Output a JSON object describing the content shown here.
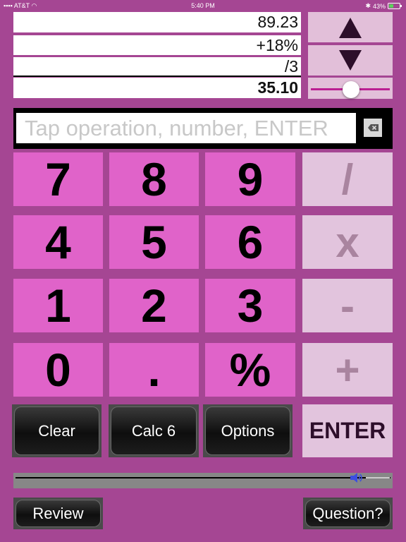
{
  "status_bar": {
    "carrier": "AT&T",
    "time": "5:40 PM",
    "battery": "43%"
  },
  "tape": {
    "lines": [
      "89.23",
      "+18%",
      "/3"
    ],
    "result": "35.10"
  },
  "adjust_slider": {
    "value": 0.4
  },
  "entry": {
    "placeholder": "Tap operation, number, ENTER"
  },
  "keypad": {
    "digits": [
      "7",
      "8",
      "9",
      "4",
      "5",
      "6",
      "1",
      "2",
      "3",
      "0",
      ".",
      "%"
    ],
    "operators": [
      "/",
      "x",
      "-",
      "+"
    ],
    "enter": "ENTER"
  },
  "buttons": {
    "clear": "Clear",
    "calc": "Calc 6",
    "options": "Options",
    "review": "Review",
    "question": "Question?"
  },
  "volume_slider": {
    "value": 0.93
  },
  "colors": {
    "background": "#a54693",
    "digit_key": "#e063c9",
    "operator_key": "#e2c4dd",
    "accent": "#bb1f92"
  }
}
